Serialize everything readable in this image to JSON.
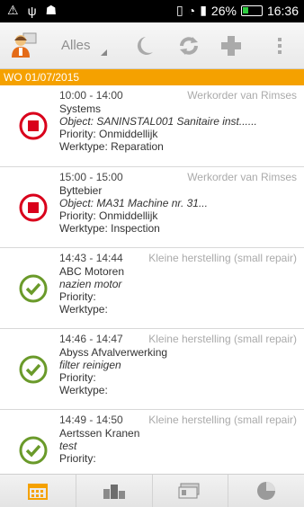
{
  "status_bar": {
    "battery": "26%",
    "time": "16:36"
  },
  "toolbar": {
    "filter_label": "Alles"
  },
  "date_header": "WO 01/07/2015",
  "items": [
    {
      "time": "10:00 - 14:00",
      "worker": "Werkorder van Rimses",
      "name": "Systems",
      "object": "Object: SANINSTAL001 Sanitaire inst......",
      "priority": "Priority: Onmiddellijk",
      "werktype": "Werktype: Reparation",
      "status": "stopped"
    },
    {
      "time": "15:00 - 15:00",
      "worker": "Werkorder van Rimses",
      "name": "Byttebier",
      "object": "Object: MA31 Machine nr. 31...",
      "priority": "Priority: Onmiddellijk",
      "werktype": "Werktype: Inspection",
      "status": "stopped"
    },
    {
      "time": "14:43 - 14:44",
      "worker": "Kleine herstelling (small repair)",
      "name": "ABC Motoren",
      "object": "nazien motor",
      "priority": "Priority:",
      "werktype": "Werktype:",
      "status": "done"
    },
    {
      "time": "14:46 - 14:47",
      "worker": "Kleine herstelling (small repair)",
      "name": "Abyss Afvalverwerking",
      "object": "filter reinigen",
      "priority": "Priority:",
      "werktype": "Werktype:",
      "status": "done"
    },
    {
      "time": "14:49 - 14:50",
      "worker": "Kleine herstelling (small repair)",
      "name": "Aertssen Kranen",
      "object": "test",
      "priority": "Priority:",
      "werktype": "",
      "status": "done"
    }
  ],
  "colors": {
    "accent": "#f5a100",
    "stopped": "#d9001b",
    "done": "#6a9a2a"
  },
  "icons": {
    "toolbar": [
      "user-icon",
      "moon-icon",
      "refresh-icon",
      "plus-icon",
      "more-icon"
    ],
    "bottom_tabs": [
      "calendar-icon",
      "buildings-icon",
      "cards-icon",
      "pie-chart-icon"
    ]
  }
}
